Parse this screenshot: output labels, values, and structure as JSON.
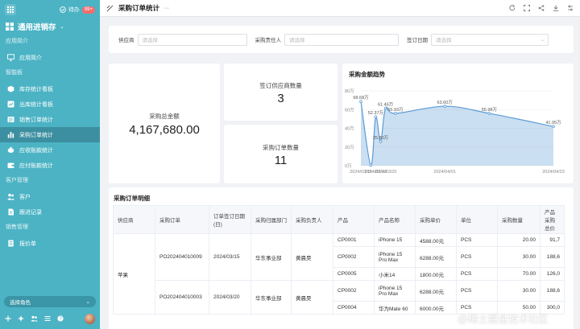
{
  "sidebar": {
    "todo_label": "待办",
    "todo_count": "99+",
    "app_name": "通用进销存",
    "groups": [
      {
        "title": "应用简介",
        "items": [
          {
            "label": "应用简介",
            "icon": "monitor-icon"
          }
        ]
      },
      {
        "title": "智能板",
        "items": [
          {
            "label": "库存统计看板",
            "icon": "box-icon"
          },
          {
            "label": "出库统计看板",
            "icon": "chart-icon"
          },
          {
            "label": "销售订单统计",
            "icon": "report-icon"
          },
          {
            "label": "采购订单统计",
            "icon": "bar-chart-icon",
            "active": true
          },
          {
            "label": "应收账款统计",
            "icon": "piggy-bank-icon"
          },
          {
            "label": "应付账款统计",
            "icon": "wallet-icon"
          }
        ]
      },
      {
        "title": "客户管理",
        "items": [
          {
            "label": "客户",
            "icon": "users-icon"
          },
          {
            "label": "跟进记录",
            "icon": "note-icon"
          }
        ]
      },
      {
        "title": "销售管理",
        "items": [
          {
            "label": "报价单",
            "icon": "document-icon"
          }
        ]
      }
    ],
    "role_select": "选择角色"
  },
  "header": {
    "title": "采购订单统计",
    "more": "···"
  },
  "filters": [
    {
      "label": "供应商",
      "placeholder": "请选择"
    },
    {
      "label": "采购责任人",
      "placeholder": "请选择"
    },
    {
      "label": "签订日期",
      "placeholder": "请选择"
    }
  ],
  "kpi": {
    "total_label": "采购总金额",
    "total_value": "4,167,680.00",
    "supplier_label": "签订供应商数量",
    "supplier_value": "3",
    "orders_label": "采购订单数量",
    "orders_value": "11"
  },
  "chart_data": {
    "type": "area",
    "title": "采购金额趋势",
    "yticks": [
      "80万",
      "60万",
      "40万",
      "20万",
      "0万"
    ],
    "ylim": [
      0,
      80
    ],
    "xticks": [
      "2024/03/15",
      "2024/03/18",
      "2024/03/20",
      "2024/04/01",
      "2024/04/23"
    ],
    "points": [
      {
        "x": "2024/03/15",
        "y": 68.68,
        "label": "68.68万"
      },
      {
        "x": "2024/03/17",
        "y": 0.5,
        "label": ""
      },
      {
        "x": "2024/03/18",
        "y": 52.37,
        "label": "52.37万"
      },
      {
        "x": "2024/03/19",
        "y": 25.8,
        "label": "25.80万"
      },
      {
        "x": "2024/03/20",
        "y": 61.46,
        "label": "61.46万"
      },
      {
        "x": "2024/03/22",
        "y": 55.93,
        "label": "55.93万"
      },
      {
        "x": "2024/04/01",
        "y": 63.6,
        "label": "63.60万"
      },
      {
        "x": "2024/04/10",
        "y": 55.98,
        "label": "55.98万"
      },
      {
        "x": "2024/04/23",
        "y": 41.95,
        "label": "41.95万"
      }
    ],
    "color": "#5b9bd5"
  },
  "table": {
    "title": "采购订单明细",
    "headers": [
      "供应商",
      "采购订单",
      "订单签订日期(日)",
      "采购归属部门",
      "采购负责人",
      "产品",
      "产品名称",
      "采购单价",
      "单位",
      "采购数量",
      "产品采购总价"
    ],
    "groups": [
      {
        "supplier": "苹果",
        "orders": [
          {
            "order": "PO202404010009",
            "date": "2024/03/15",
            "dept": "华东事业部",
            "owner": "黄晨昊",
            "lines": [
              {
                "code": "CP0001",
                "name": "iPhone 15",
                "price": "4588.00元",
                "unit": "PCS",
                "qty": "20.00",
                "total": "91,7"
              },
              {
                "code": "CP0002",
                "name": "iPhone 15 Pro Max",
                "price": "6288.00元",
                "unit": "PCS",
                "qty": "30.00",
                "total": "188,6"
              },
              {
                "code": "CP0005",
                "name": "小米14",
                "price": "1800.00元",
                "unit": "PCS",
                "qty": "70.00",
                "total": "126,0"
              }
            ]
          },
          {
            "order": "PO202404010003",
            "date": "2024/03/20",
            "dept": "华东事业部",
            "owner": "黄晨昊",
            "lines": [
              {
                "code": "CP0002",
                "name": "iPhone 15 Pro Max",
                "price": "6288.00元",
                "unit": "PCS",
                "qty": "30.00",
                "total": "188,6"
              },
              {
                "code": "CP0004",
                "name": "华为Mate 60",
                "price": "6000.00元",
                "unit": "PCS",
                "qty": "50.00",
                "total": "300,0"
              }
            ]
          }
        ]
      }
    ]
  },
  "watermark": "@稀土掘金技术社区"
}
